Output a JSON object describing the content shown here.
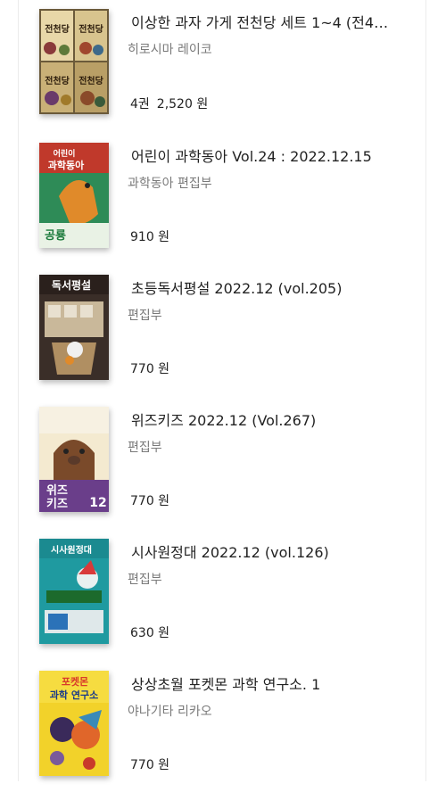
{
  "books": [
    {
      "title": "이상한 과자 가게 전천당 세트 1~4 (전4…",
      "author": "히로시마 레이코",
      "count": "4권",
      "price": "2,520 원",
      "cover_icon": "cover-jeoncheondang-set"
    },
    {
      "title": "어린이 과학동아 Vol.24 : 2022.12.15",
      "author": "과학동아 편집부",
      "count": "",
      "price": "910 원",
      "cover_icon": "cover-kids-science-donga"
    },
    {
      "title": "초등독서평설 2022.12 (vol.205)",
      "author": "편집부",
      "count": "",
      "price": "770 원",
      "cover_icon": "cover-reading-review"
    },
    {
      "title": "위즈키즈 2022.12 (Vol.267)",
      "author": "편집부",
      "count": "",
      "price": "770 원",
      "cover_icon": "cover-wiz-kids"
    },
    {
      "title": "시사원정대 2022.12 (vol.126)",
      "author": "편집부",
      "count": "",
      "price": "630 원",
      "cover_icon": "cover-current-affairs"
    },
    {
      "title": "상상초월 포켓몬 과학 연구소. 1",
      "author": "야나기타 리카오",
      "count": "",
      "price": "770 원",
      "cover_icon": "cover-pokemon-science"
    }
  ],
  "cover_texts": {
    "b0": "전천당",
    "b1_a": "어린이",
    "b1_b": "과학동아",
    "b1_c": "공룡",
    "b2": "독서평설",
    "b3_a": "위즈",
    "b3_b": "키즈",
    "b3_c": "12",
    "b4": "시사원정대",
    "b5_a": "포켓몬",
    "b5_b": "과학 연구소"
  }
}
